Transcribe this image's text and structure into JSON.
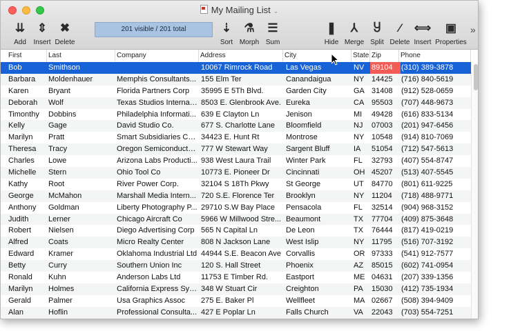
{
  "window": {
    "title": "My Mailing List"
  },
  "toolbar": {
    "status_text": "201 visible / 201 total",
    "left_buttons": [
      {
        "label": "Add",
        "icon": "add-icon"
      },
      {
        "label": "Insert",
        "icon": "insert-icon"
      },
      {
        "label": "Delete",
        "icon": "delete-icon"
      }
    ],
    "mid_buttons": [
      {
        "label": "Sort",
        "icon": "sort-icon"
      },
      {
        "label": "Morph",
        "icon": "morph-icon"
      },
      {
        "label": "Sum",
        "icon": "sum-icon"
      }
    ],
    "right_buttons": [
      {
        "label": "Hide",
        "icon": "hide-icon"
      },
      {
        "label": "Merge",
        "icon": "merge-icon"
      },
      {
        "label": "Split",
        "icon": "split-icon"
      },
      {
        "label": "Delete",
        "icon": "delete-column-icon"
      },
      {
        "label": "Insert",
        "icon": "insert-column-icon"
      },
      {
        "label": "Properties",
        "icon": "properties-icon"
      }
    ]
  },
  "columns": [
    "First",
    "Last",
    "Company",
    "Address",
    "City",
    "State",
    "Zip",
    "Phone"
  ],
  "rows": [
    [
      "Bob",
      "Smithson",
      "",
      "10067 Rimrock Road",
      "Las Vegas",
      "NV",
      "89104",
      "(310) 389-3878"
    ],
    [
      "Barbara",
      "Moldenhauer",
      "Memphis Consultants...",
      "155 Elm Ter",
      "Canandaigua",
      "NY",
      "14425",
      "(716) 840-5619"
    ],
    [
      "Karen",
      "Bryant",
      "Florida Partners Corp",
      "35995 E 5Th Blvd.",
      "Garden City",
      "GA",
      "31408",
      "(912) 528-0659"
    ],
    [
      "Deborah",
      "Wolf",
      "Texas Studios Internat...",
      "8503 E. Glenbrook Ave.",
      "Eureka",
      "CA",
      "95503",
      "(707) 448-9673"
    ],
    [
      "Timonthy",
      "Dobbins",
      "Philadelphia Informati...",
      "639 E Clayton Ln",
      "Jenison",
      "MI",
      "49428",
      "(616) 833-5134"
    ],
    [
      "Kelly",
      "Gage",
      "David Studio Co.",
      "677 S. Charlotte Lane",
      "Bloomfield",
      "NJ",
      "07003",
      "(201) 947-6456"
    ],
    [
      "Marilyn",
      "Pratt",
      "Smart Subsidiaries Co...",
      "34423 E. Hunt Rt",
      "Montrose",
      "NY",
      "10548",
      "(914) 810-7069"
    ],
    [
      "Theresa",
      "Tracy",
      "Oregon Semiconductor...",
      "777 W Stewart Way",
      "Sargent Bluff",
      "IA",
      "51054",
      "(712) 547-5613"
    ],
    [
      "Charles",
      "Lowe",
      "Arizona Labs Producti...",
      "938 West Laura Trail",
      "Winter Park",
      "FL",
      "32793",
      "(407) 554-8747"
    ],
    [
      "Michelle",
      "Stern",
      "Ohio Tool Co",
      "10773 E. Pioneer Dr",
      "Cincinnati",
      "OH",
      "45207",
      "(513) 407-5545"
    ],
    [
      "Kathy",
      "Root",
      "River Power Corp.",
      "32104 S 18Th Pkwy",
      "St George",
      "UT",
      "84770",
      "(801) 611-9225"
    ],
    [
      "George",
      "McMahon",
      "Marshall Media Intern...",
      "720 S.E. Florence Ter",
      "Brooklyn",
      "NY",
      "11204",
      "(718) 488-9771"
    ],
    [
      "Anthony",
      "Goldman",
      "Liberty Photography P...",
      "29710 S.W Bay Place",
      "Pensacola",
      "FL",
      "32514",
      "(904) 968-3152"
    ],
    [
      "Judith",
      "Lerner",
      "Chicago Aircraft Co",
      "5966 W Millwood Stre...",
      "Beaumont",
      "TX",
      "77704",
      "(409) 875-3648"
    ],
    [
      "Robert",
      "Nielsen",
      "Diego Advertising Corp",
      "565 N Capital Ln",
      "De Leon",
      "TX",
      "76444",
      "(817) 419-0219"
    ],
    [
      "Alfred",
      "Coats",
      "Micro Realty Center",
      "808 N Jackson Lane",
      "West Islip",
      "NY",
      "11795",
      "(516) 707-3192"
    ],
    [
      "Edward",
      "Kramer",
      "Oklahoma Industrial Ltd",
      "44944 S.E. Beacon Ave",
      "Corvallis",
      "OR",
      "97333",
      "(541) 912-7577"
    ],
    [
      "Betty",
      "Curry",
      "Southern Union Inc",
      "120 S. Hall Street",
      "Phoenix",
      "AZ",
      "85015",
      "(602) 741-0954"
    ],
    [
      "Ronald",
      "Kuhn",
      "Anderson Labs Ltd",
      "11753 E Timber Rd.",
      "Eastport",
      "ME",
      "04631",
      "(207) 339-1356"
    ],
    [
      "Marilyn",
      "Holmes",
      "California Express Sys...",
      "348 W Stuart Cir",
      "Creighton",
      "PA",
      "15030",
      "(412) 735-1934"
    ],
    [
      "Gerald",
      "Palmer",
      "Usa Graphics Assoc",
      "275 E. Baker Pl",
      "Wellfleet",
      "MA",
      "02667",
      "(508) 394-9409"
    ],
    [
      "Alan",
      "Hoflin",
      "Professional Consulta...",
      "427 E Poplar Ln",
      "Falls Church",
      "VA",
      "22043",
      "(703) 554-7251"
    ]
  ],
  "colors": {
    "selection": "#1662d6",
    "zip_highlight": "#f15c55",
    "status_bg": "#a9c3e2"
  }
}
